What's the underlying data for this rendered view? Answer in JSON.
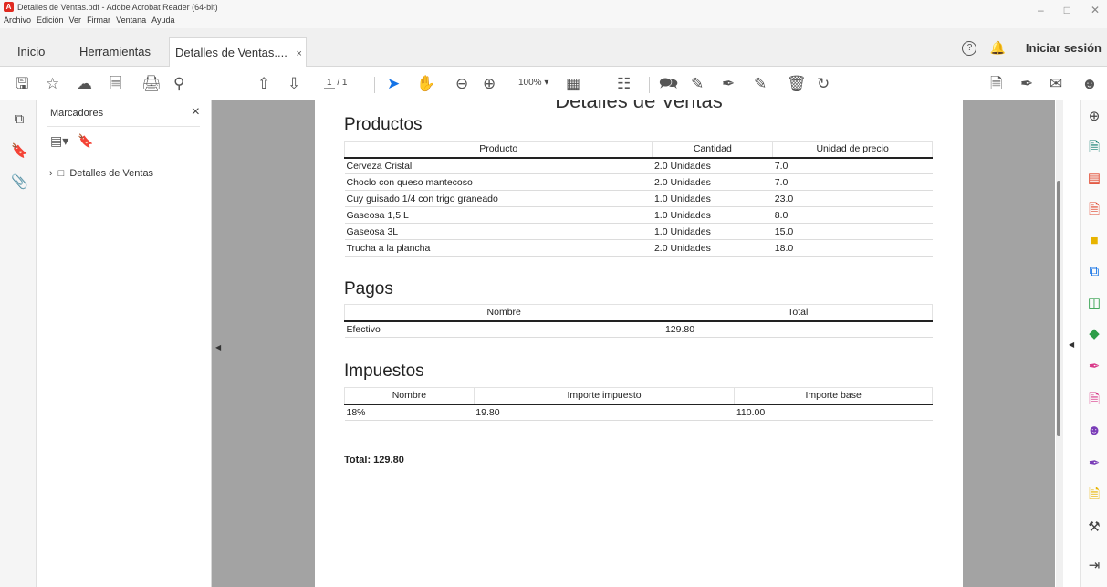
{
  "window": {
    "title": "Detalles de Ventas.pdf - Adobe Acrobat Reader (64-bit)",
    "minimize": "–",
    "restore": "□",
    "close": "✕"
  },
  "menubar": [
    "Archivo",
    "Edición",
    "Ver",
    "Firmar",
    "Ventana",
    "Ayuda"
  ],
  "tabs": {
    "home": "Inicio",
    "tools": "Herramientas",
    "document": "Detalles de Ventas....",
    "close": "×"
  },
  "header_right": {
    "help": "?",
    "signin": "Iniciar sesión"
  },
  "toolbar": {
    "page_current": "1",
    "page_total": "/ 1",
    "zoom": "100%"
  },
  "bookmarks": {
    "title": "Marcadores",
    "close": "×",
    "items": [
      {
        "label": "Detalles de Ventas"
      }
    ]
  },
  "document": {
    "title": "Detalles de Ventas",
    "productos": {
      "heading": "Productos",
      "columns": [
        "Producto",
        "Cantidad",
        "Unidad de precio"
      ],
      "rows": [
        [
          "Cerveza Cristal",
          "2.0 Unidades",
          "7.0"
        ],
        [
          "Choclo con queso mantecoso",
          "2.0 Unidades",
          "7.0"
        ],
        [
          "Cuy guisado 1/4 con trigo graneado",
          "1.0 Unidades",
          "23.0"
        ],
        [
          "Gaseosa 1,5 L",
          "1.0 Unidades",
          "8.0"
        ],
        [
          "Gaseosa 3L",
          "1.0 Unidades",
          "15.0"
        ],
        [
          "Trucha a la plancha",
          "2.0 Unidades",
          "18.0"
        ]
      ]
    },
    "pagos": {
      "heading": "Pagos",
      "columns": [
        "Nombre",
        "Total"
      ],
      "rows": [
        [
          "Efectivo",
          "129.80"
        ]
      ]
    },
    "impuestos": {
      "heading": "Impuestos",
      "columns": [
        "Nombre",
        "Importe impuesto",
        "Importe base"
      ],
      "rows": [
        [
          "18%",
          "19.80",
          "110.00"
        ]
      ]
    },
    "total": "Total: 129.80"
  }
}
